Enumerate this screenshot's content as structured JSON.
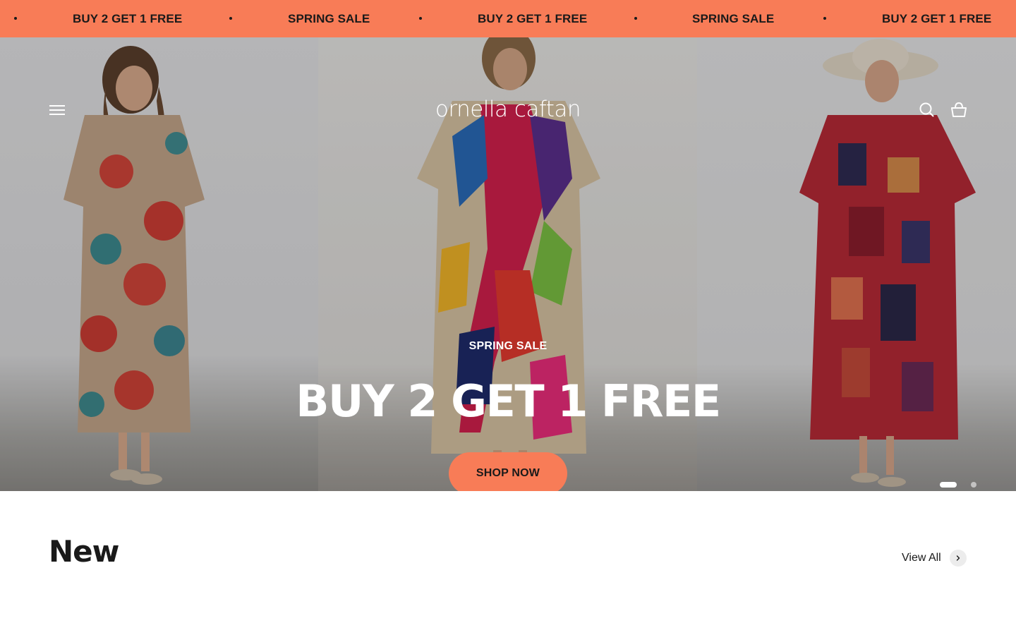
{
  "announcement": {
    "messages": [
      "BUY 2 GET 1 FREE",
      "SPRING SALE",
      "BUY 2 GET 1 FREE",
      "SPRING SALE",
      "BUY 2 GET 1 FREE"
    ]
  },
  "header": {
    "logo_text": "ornella caftan",
    "menu_icon": "hamburger-menu-icon",
    "search_icon": "search-icon",
    "cart_icon": "shopping-basket-icon"
  },
  "hero": {
    "subheading": "SPRING SALE",
    "heading": "BUY 2 GET 1 FREE",
    "cta_label": "SHOP NOW",
    "slide_count": 2,
    "active_slide": 1
  },
  "section": {
    "title": "New",
    "view_all_label": "View All",
    "view_all_icon": "chevron-right-icon"
  },
  "colors": {
    "accent": "#f87c57",
    "text": "#1a1a1a",
    "background": "#ffffff"
  }
}
